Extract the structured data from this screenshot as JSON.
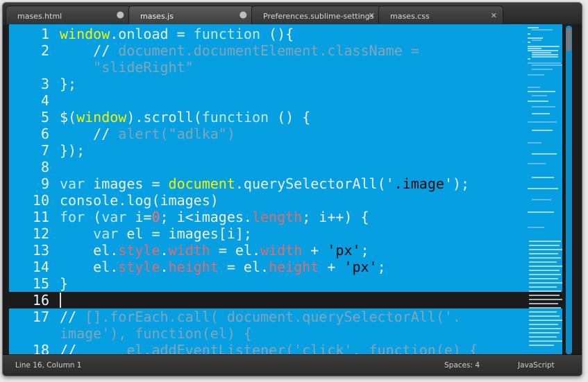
{
  "tabs": [
    {
      "label": "mases.html",
      "control": "●"
    },
    {
      "label": "mases.js",
      "control": "●"
    },
    {
      "label": "Preferences.sublime-settings",
      "control": "✕"
    },
    {
      "label": "mases.css",
      "control": "✕"
    }
  ],
  "line_numbers": [
    "1",
    "2",
    "3",
    "4",
    "5",
    "6",
    "7",
    "8",
    "9",
    "10",
    "11",
    "12",
    "13",
    "14",
    "15",
    "16",
    "17",
    "18"
  ],
  "code": {
    "l1": {
      "a": "window",
      "b": ".",
      "c": "onload",
      "d": " = ",
      "e": "function",
      "f": " (){"
    },
    "l2a": {
      "a": "    // ",
      "b": "document.documentElement.className ="
    },
    "l2b": {
      "a": "    \"slideRight\""
    },
    "l3": {
      "a": "};"
    },
    "l5": {
      "a": "$(",
      "b": "window",
      "c": ").",
      "d": "scroll",
      "e": "(",
      "f": "function",
      "g": " () {"
    },
    "l6": {
      "a": "    // ",
      "b": "alert(\"adlka\")"
    },
    "l7": {
      "a": "});"
    },
    "l9": {
      "a": "var",
      "b": " images = ",
      "c": "document",
      "d": ".",
      "e": "querySelectorAll",
      "f": "('",
      "g": ".image",
      "h": "');"
    },
    "l10": {
      "a": "console",
      "b": ".",
      "c": "log",
      "d": "(images)"
    },
    "l11": {
      "a": "for",
      "b": " (",
      "c": "var",
      "d": " i=",
      "e": "0",
      "f": "; i<images.",
      "g": "length",
      "h": "; i++) {"
    },
    "l12": {
      "a": "    ",
      "b": "var",
      "c": " el = images[i];"
    },
    "l13": {
      "a": "    el.",
      "b": "style",
      "c": ".",
      "d": "width",
      "e": " = el.",
      "f": "width",
      "g": " + ",
      "h": "'px'",
      "i": ";"
    },
    "l14": {
      "a": "    el.",
      "b": "style",
      "c": ".",
      "d": "height",
      "e": " = el.",
      "f": "height",
      "g": " + ",
      "h": "'px'",
      "i": ";"
    },
    "l15": {
      "a": "}"
    },
    "l17a": {
      "a": "// ",
      "b": "[].forEach.call( document.querySelectorAll('."
    },
    "l17b": {
      "a": "image'), function(el) {"
    },
    "l18": {
      "a": "//      ",
      "b": "el.addEventListener('click', function(e) {"
    }
  },
  "status": {
    "position": "Line 16, Column 1",
    "spaces": "Spaces: 4",
    "syntax": "JavaScript"
  },
  "colors": {
    "editor_bg": "#06a0e2",
    "current_line": "#1a1a1a",
    "keyword": "#f4f400",
    "property": "#e36b6b"
  },
  "icons": [
    "dirty-dot-icon",
    "close-icon"
  ]
}
